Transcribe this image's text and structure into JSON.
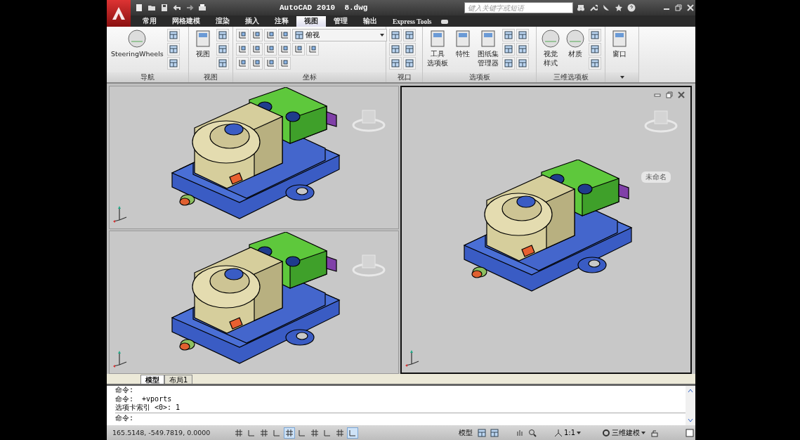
{
  "title_bar": {
    "title": "AutoCAD 2010  8.dwg",
    "search": {
      "placeholder": "键入关键字或短语"
    }
  },
  "tabs": [
    {
      "label": "常用",
      "selected": false
    },
    {
      "label": "网格建模",
      "selected": false
    },
    {
      "label": "渲染",
      "selected": false
    },
    {
      "label": "插入",
      "selected": false
    },
    {
      "label": "注释",
      "selected": false
    },
    {
      "label": "视图",
      "selected": true
    },
    {
      "label": "管理",
      "selected": false
    },
    {
      "label": "输出",
      "selected": false
    },
    {
      "label": "Express Tools",
      "selected": false
    }
  ],
  "ribbon": {
    "panels": [
      {
        "title": "导航",
        "buttons": [
          {
            "label_lines": [
              "SteeringWheels"
            ]
          }
        ]
      },
      {
        "title": "视图",
        "buttons": [
          {
            "label_lines": [
              "视图"
            ]
          }
        ]
      },
      {
        "title": "坐标",
        "dropdown": "俯视"
      },
      {
        "title": "视口"
      },
      {
        "title": "选项板",
        "buttons": [
          {
            "label_lines": [
              "工具",
              "选项板"
            ]
          },
          {
            "label_lines": [
              "特性"
            ]
          },
          {
            "label_lines": [
              "图纸集",
              "管理器"
            ]
          }
        ]
      },
      {
        "title": "三维选项板",
        "buttons": [
          {
            "label_lines": [
              "视觉",
              "样式"
            ]
          },
          {
            "label_lines": [
              "材质"
            ]
          }
        ]
      },
      {
        "buttons": [
          {
            "label_lines": [
              "窗口"
            ]
          }
        ]
      }
    ]
  },
  "viewports": [
    {
      "active": false
    },
    {
      "active": false
    },
    {
      "active": true,
      "view_label": "未命名"
    }
  ],
  "layout_tabs": [
    {
      "label": "模型",
      "selected": true
    },
    {
      "label": "布局1",
      "selected": false
    }
  ],
  "command_lines": [
    "命令:",
    "命令:  +vports",
    "选项卡索引 <0>: 1"
  ],
  "command_prompt": "命令:",
  "status_bar": {
    "coordinates": "165.5148, -549.7819, 0.0000",
    "toggles": [
      {
        "on": false
      },
      {
        "on": false
      },
      {
        "on": false
      },
      {
        "on": false
      },
      {
        "on": true
      },
      {
        "on": false
      },
      {
        "on": false
      },
      {
        "on": false
      },
      {
        "on": false
      },
      {
        "on": true
      }
    ],
    "space": "模型",
    "scale": "1:1",
    "workspace": "三维建模"
  }
}
